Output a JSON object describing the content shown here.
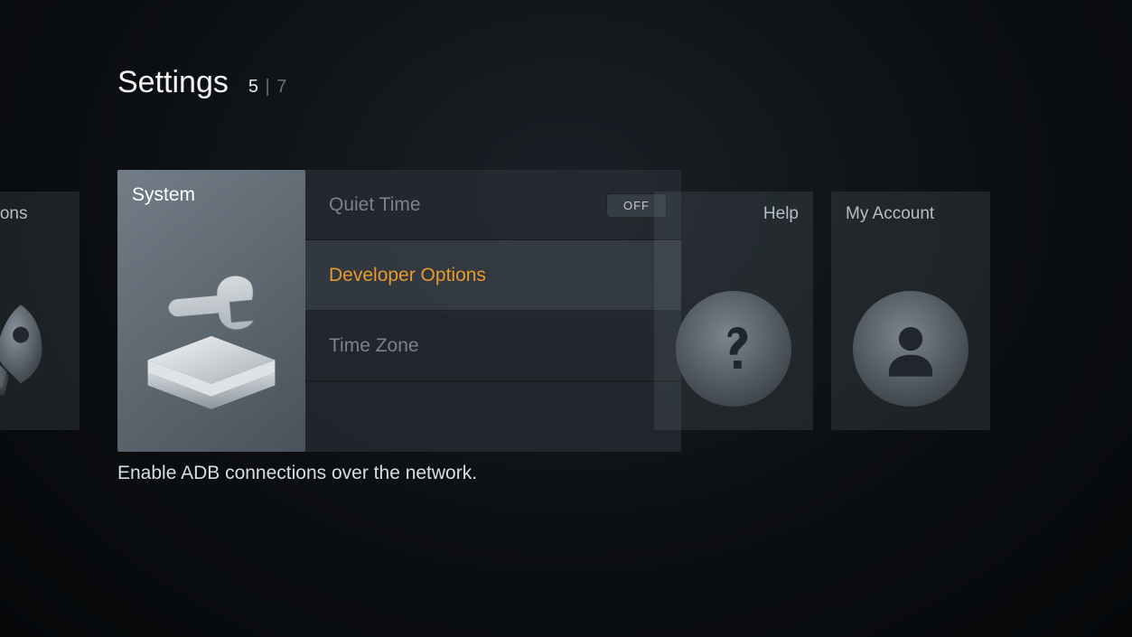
{
  "header": {
    "title": "Settings",
    "current": "5",
    "total": "7"
  },
  "tiles": {
    "applications": {
      "label": "Applications"
    },
    "system": {
      "label": "System"
    },
    "help": {
      "label": "Help"
    },
    "account": {
      "label": "My Account"
    }
  },
  "submenu": {
    "items": [
      {
        "label": "Quiet Time",
        "toggle": "OFF",
        "selected": false
      },
      {
        "label": "Developer Options",
        "selected": true
      },
      {
        "label": "Time Zone",
        "selected": false
      }
    ]
  },
  "description": "Enable ADB connections over the network.",
  "colors": {
    "accent": "#e79a2c"
  }
}
